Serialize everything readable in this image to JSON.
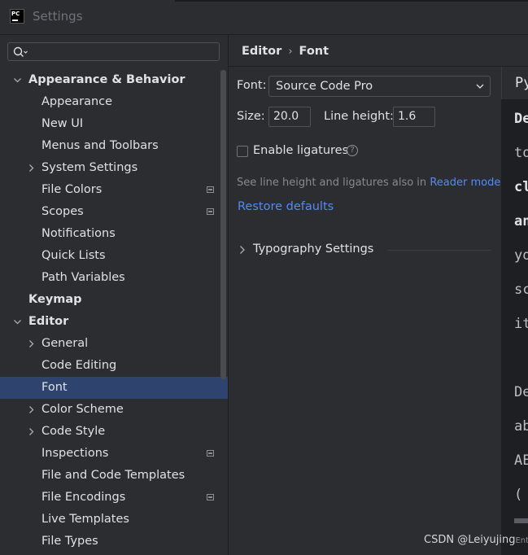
{
  "window": {
    "title": "Settings",
    "app_logo_text": "PC"
  },
  "search": {
    "placeholder": "",
    "value": ""
  },
  "tree": [
    {
      "label": "Appearance & Behavior",
      "level": 0,
      "bold": true,
      "expanded": true
    },
    {
      "label": "Appearance",
      "level": 1
    },
    {
      "label": "New UI",
      "level": 1
    },
    {
      "label": "Menus and Toolbars",
      "level": 1
    },
    {
      "label": "System Settings",
      "level": 1,
      "collapsed": true
    },
    {
      "label": "File Colors",
      "level": 1,
      "modified": true
    },
    {
      "label": "Scopes",
      "level": 1,
      "modified": true
    },
    {
      "label": "Notifications",
      "level": 1
    },
    {
      "label": "Quick Lists",
      "level": 1
    },
    {
      "label": "Path Variables",
      "level": 1
    },
    {
      "label": "Keymap",
      "level": 0,
      "bold": true
    },
    {
      "label": "Editor",
      "level": 0,
      "bold": true,
      "expanded": true
    },
    {
      "label": "General",
      "level": 1,
      "collapsed": true
    },
    {
      "label": "Code Editing",
      "level": 1
    },
    {
      "label": "Font",
      "level": 1,
      "selected": true
    },
    {
      "label": "Color Scheme",
      "level": 1,
      "collapsed": true
    },
    {
      "label": "Code Style",
      "level": 1,
      "collapsed": true
    },
    {
      "label": "Inspections",
      "level": 1,
      "modified": true
    },
    {
      "label": "File and Code Templates",
      "level": 1
    },
    {
      "label": "File Encodings",
      "level": 1,
      "modified": true
    },
    {
      "label": "Live Templates",
      "level": 1
    },
    {
      "label": "File Types",
      "level": 1
    }
  ],
  "breadcrumb": {
    "parent": "Editor",
    "separator": "›",
    "current": "Font"
  },
  "font_settings": {
    "font_label": "Font:",
    "font_value": "Source Code Pro",
    "size_label": "Size:",
    "size_value": "20.0",
    "line_height_label": "Line height:",
    "line_height_value": "1.6",
    "ligatures_label": "Enable ligatures",
    "ligatures_checked": false,
    "help_glyph": "?",
    "hint_text": "See line height and ligatures also in",
    "hint_link": "Reader mode",
    "restore_label": "Restore defaults",
    "typography_label": "Typography Settings"
  },
  "preview": {
    "tab_label": "Py",
    "lines": [
      {
        "text": "De",
        "bold": true
      },
      {
        "text": "to",
        "bold": false
      },
      {
        "text": "cl",
        "bold": true
      },
      {
        "text": "an",
        "bold": true
      },
      {
        "text": "yo",
        "bold": false
      },
      {
        "text": "sc",
        "bold": false
      },
      {
        "text": "it",
        "bold": false
      },
      {
        "text": "",
        "bold": false
      },
      {
        "text": "De",
        "bold": false
      },
      {
        "text": "ab",
        "bold": false
      },
      {
        "text": "AE",
        "bold": false
      },
      {
        "text": "(",
        "bold": false
      }
    ]
  },
  "watermark": {
    "text": "CSDN @Leiyujing",
    "tail": "Ent"
  },
  "colors": {
    "background": "#2b2d30",
    "selection": "#2e436e",
    "link": "#548af7",
    "text": "#dfe1e5",
    "hint": "#868a91"
  }
}
